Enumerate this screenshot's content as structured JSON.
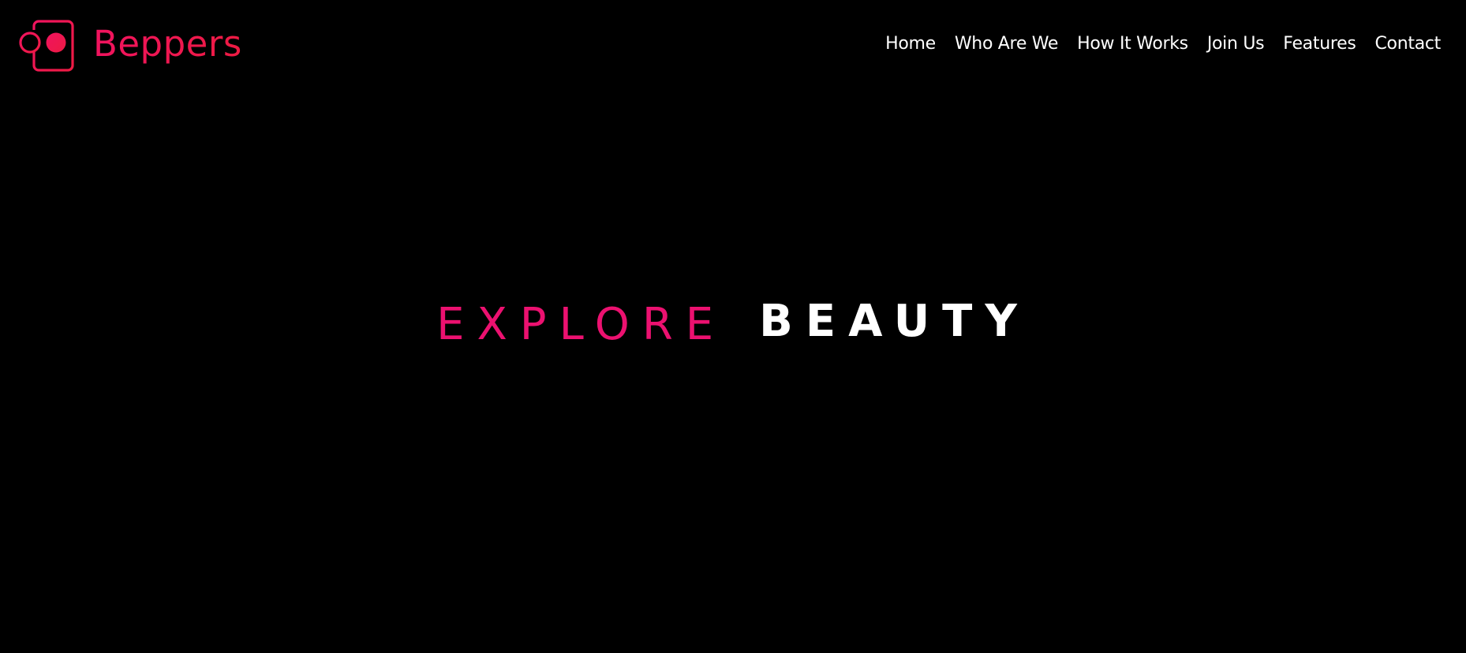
{
  "brand": {
    "name": "Beppers",
    "logo_icon": "camera-square-icon",
    "colors": {
      "primary": "#f0135f",
      "secondary": "#ee1b43"
    }
  },
  "nav": {
    "items": [
      {
        "label": "Home"
      },
      {
        "label": "Who Are We"
      },
      {
        "label": "How It Works"
      },
      {
        "label": "Join Us"
      },
      {
        "label": "Features"
      },
      {
        "label": "Contact"
      }
    ]
  },
  "hero": {
    "word1": "EXPLORE",
    "word2": "BEAUTY",
    "colors": {
      "word1": "#ec1170",
      "word2": "#ffffff"
    }
  },
  "page": {
    "background": "#000000"
  }
}
